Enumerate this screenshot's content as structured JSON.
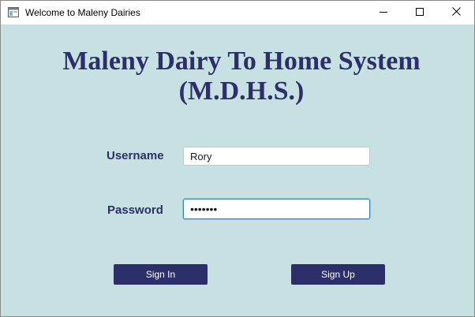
{
  "window": {
    "title": "Welcome to Maleny Dairies",
    "app_icon": "window-app-icon",
    "controls": {
      "minimize_icon": "minimize-icon",
      "maximize_icon": "maximize-icon",
      "close_icon": "close-icon"
    }
  },
  "heading": {
    "line1": "Maleny Dairy To Home System",
    "line2": "(M.D.H.S.)"
  },
  "form": {
    "username_label": "Username",
    "username_value": "Rory",
    "password_label": "Password",
    "password_value": "•••••••"
  },
  "buttons": {
    "sign_in": "Sign In",
    "sign_up": "Sign Up"
  },
  "colors": {
    "background": "#c7e1e3",
    "accent": "#2c2f69",
    "focus_border": "#2f86c9"
  }
}
